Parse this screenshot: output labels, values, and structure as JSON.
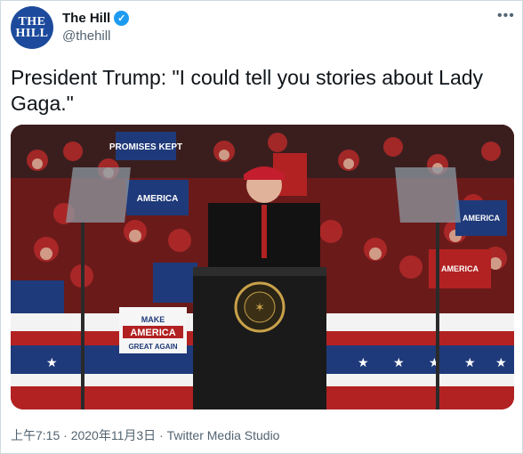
{
  "author": {
    "name": "The Hill",
    "handle": "@thehill",
    "avatar_text_line1": "THE",
    "avatar_text_line2": "HILL",
    "verified_icon": "verified-badge-icon"
  },
  "menu_icon": "more-icon",
  "tweet": {
    "text": "President Trump: \"I could tell you stories about Lady Gaga.\""
  },
  "media": {
    "signs": {
      "promises": "PROMISES KEPT",
      "maga": "MAKE AMERICA GREAT AGAIN",
      "make": "MAKE",
      "america": "AMERICA",
      "great_again": "GREAT AGAIN"
    }
  },
  "footer": {
    "time": "上午7:15",
    "separator": "·",
    "date": "2020年11月3日",
    "source": "Twitter Media Studio"
  }
}
